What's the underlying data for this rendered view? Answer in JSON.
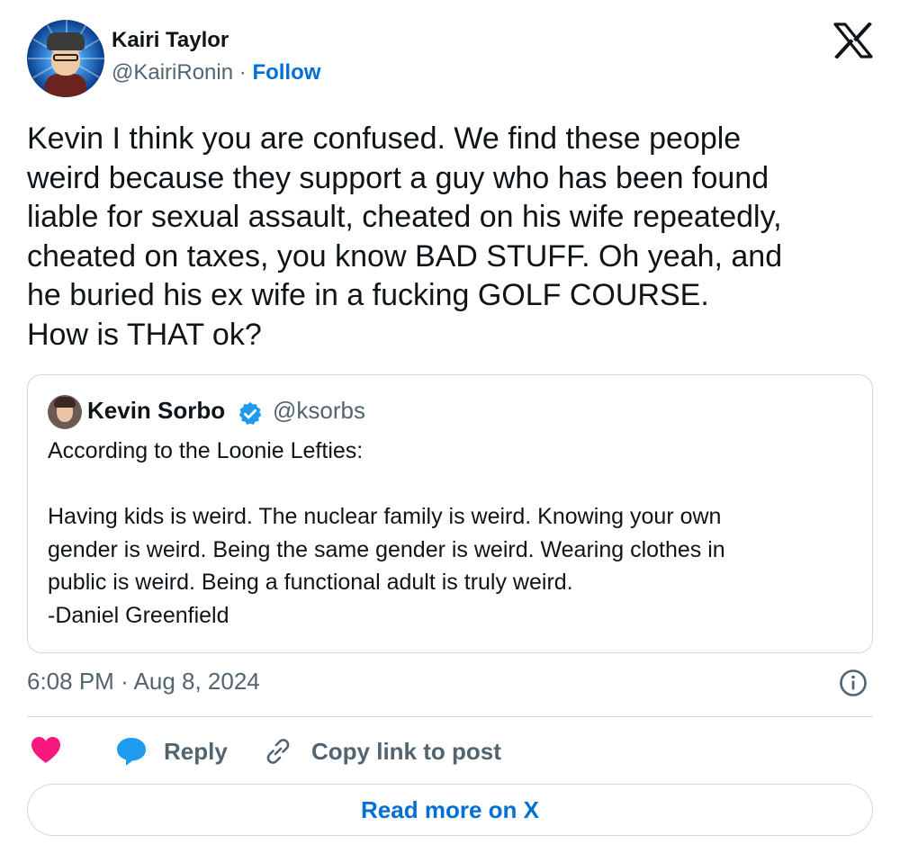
{
  "author": {
    "name": "Kairi Taylor",
    "handle": "@KairiRonin",
    "separator": "·",
    "follow_label": "Follow"
  },
  "tweet": {
    "text": "Kevin I think you are confused. We find these people\nweird because they support a guy who has been found\nliable for sexual assault, cheated on his wife repeatedly,\ncheated on taxes, you know BAD STUFF. Oh yeah, and\nhe buried his ex wife in a fucking GOLF COURSE.\nHow is THAT ok?",
    "time": "6:08 PM",
    "date": "Aug 8, 2024"
  },
  "quote": {
    "name": "Kevin Sorbo",
    "handle": "@ksorbs",
    "verified": true,
    "text": "According to the Loonie Lefties:\n\nHaving kids is weird. The nuclear family is weird. Knowing your own\ngender is weird. Being the same gender is weird. Wearing clothes in\npublic is weird. Being a functional adult is truly weird.\n-Daniel Greenfield"
  },
  "actions": {
    "reply_label": "Reply",
    "copy_link_label": "Copy link to post",
    "read_more_label": "Read more on X"
  },
  "icons": {
    "logo": "x-logo-icon",
    "like": "heart-icon",
    "reply": "speech-bubble-icon",
    "copy": "link-icon",
    "info": "info-icon",
    "verified": "verified-badge-icon"
  },
  "colors": {
    "text": "#0f1419",
    "muted": "#536471",
    "link": "#006fd6",
    "border": "#cfd9de",
    "heart": "#f91880",
    "reply": "#1d9bf0",
    "verified": "#1d9bf0"
  }
}
